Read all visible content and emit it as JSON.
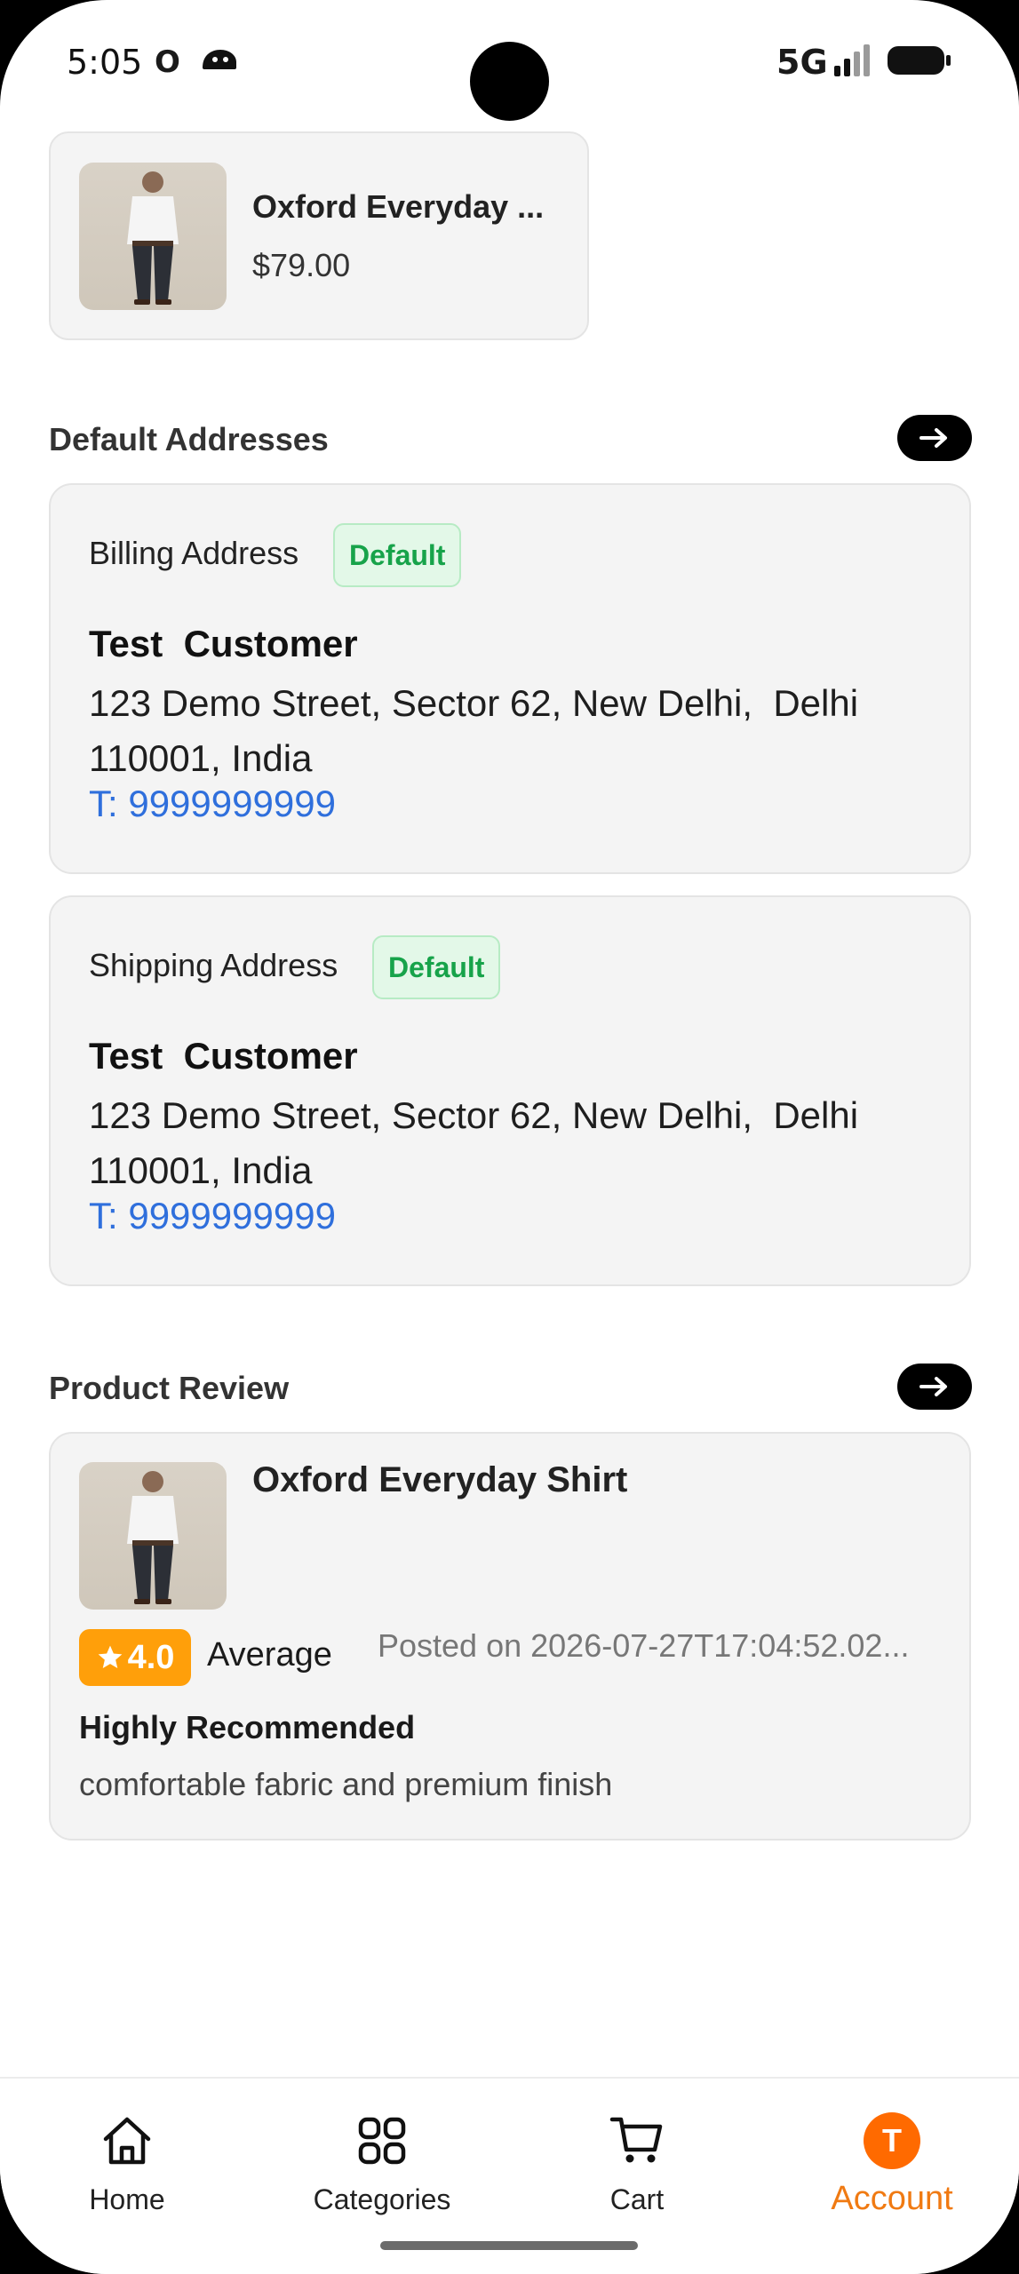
{
  "status_bar": {
    "time": "5:05",
    "carrier_icon_text": "O",
    "network": "5G"
  },
  "order_item": {
    "name": "Oxford Everyday ...",
    "price": "$79.00"
  },
  "addresses_section": {
    "title": "Default Addresses",
    "cards": [
      {
        "type": "Billing Address",
        "badge": "Default",
        "name": "Test  Customer",
        "address": "123 Demo Street, Sector 62, New Delhi,  Delhi\n110001, India",
        "phone": "T: 9999999999"
      },
      {
        "type": "Shipping Address",
        "badge": "Default",
        "name": "Test  Customer",
        "address": "123 Demo Street, Sector 62, New Delhi,  Delhi\n110001, India",
        "phone": "T: 9999999999"
      }
    ]
  },
  "review_section": {
    "title": "Product Review",
    "product": "Oxford Everyday Shirt",
    "rating": "4.0",
    "rating_label": "Average",
    "posted": "Posted on 2026-07-27T17:04:52.02...",
    "review_title": "Highly Recommended",
    "review_body": "comfortable fabric and premium finish"
  },
  "bottom_nav": {
    "items": [
      {
        "label": "Home",
        "icon": "home-icon"
      },
      {
        "label": "Categories",
        "icon": "grid-icon"
      },
      {
        "label": "Cart",
        "icon": "cart-icon"
      },
      {
        "label": "Account",
        "icon": "avatar",
        "avatar_letter": "T",
        "active": true
      }
    ]
  },
  "colors": {
    "accent": "#f07a12",
    "avatar": "#ff6a00",
    "badge_text": "#17a34a",
    "phone_link": "#2f6fdc",
    "rating": "#ff9f0a"
  }
}
